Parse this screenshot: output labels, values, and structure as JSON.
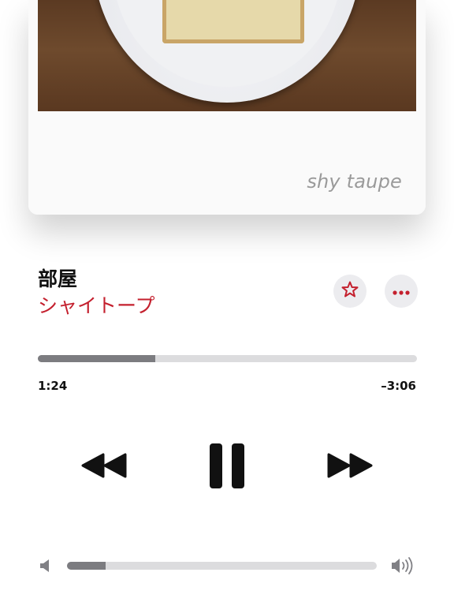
{
  "album_card": {
    "caption": "shy taupe"
  },
  "track": {
    "title": "部屋",
    "artist": "シャイトープ"
  },
  "actions": {
    "favorite_icon": "star-icon",
    "more_icon": "ellipsis-icon"
  },
  "progress": {
    "elapsed": "1:24",
    "remaining": "–3:06",
    "fraction": 0.31
  },
  "controls": {
    "previous_icon": "rewind-icon",
    "play_state_icon": "pause-icon",
    "next_icon": "fast-forward-icon"
  },
  "volume": {
    "level": 0.125,
    "min_icon": "speaker-low-icon",
    "max_icon": "speaker-high-icon"
  },
  "colors": {
    "accent": "#c4202e",
    "progress_fill": "#7c7c80",
    "track_bg": "#dcdcde"
  }
}
